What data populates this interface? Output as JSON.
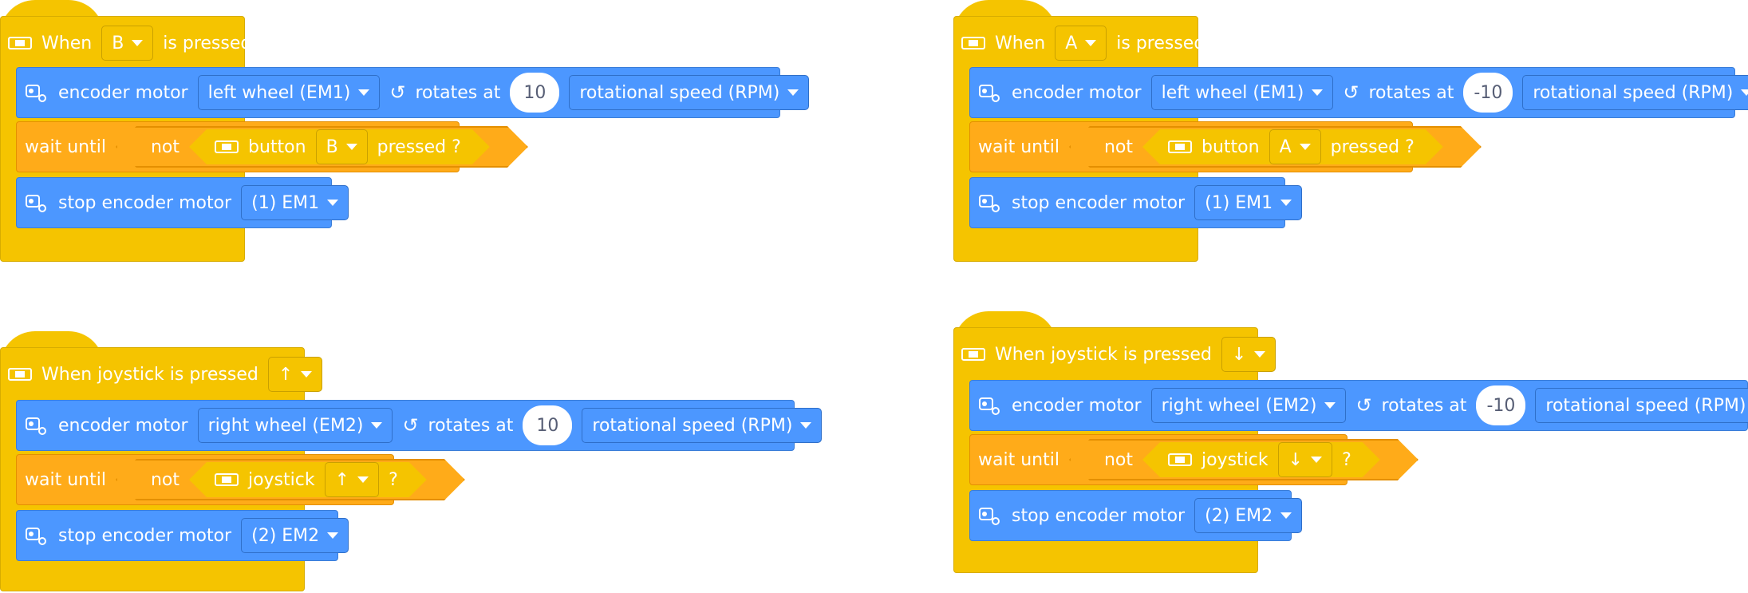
{
  "scripts": [
    {
      "hat": {
        "when": "When",
        "key": "B",
        "suffix": "is pressed"
      },
      "motor": {
        "label": "encoder motor",
        "port": "left wheel (EM1)",
        "rotates": "rotates at",
        "value": "10",
        "unit": "rotational speed (RPM)"
      },
      "wait": {
        "label": "wait until",
        "not": "not",
        "sensor": "button",
        "key": "B",
        "suffix": "pressed ?"
      },
      "stop": {
        "label": "stop encoder motor",
        "port": "(1) EM1"
      }
    },
    {
      "hat": {
        "when": "When",
        "key": "A",
        "suffix": "is pressed"
      },
      "motor": {
        "label": "encoder motor",
        "port": "left wheel (EM1)",
        "rotates": "rotates at",
        "value": "-10",
        "unit": "rotational speed (RPM)"
      },
      "wait": {
        "label": "wait until",
        "not": "not",
        "sensor": "button",
        "key": "A",
        "suffix": "pressed ?"
      },
      "stop": {
        "label": "stop encoder motor",
        "port": "(1) EM1"
      }
    },
    {
      "hat": {
        "when": "When joystick is pressed",
        "key": "↑"
      },
      "motor": {
        "label": "encoder motor",
        "port": "right wheel (EM2)",
        "rotates": "rotates at",
        "value": "10",
        "unit": "rotational speed (RPM)"
      },
      "wait": {
        "label": "wait until",
        "not": "not",
        "sensor": "joystick",
        "key": "↑",
        "suffix": "?"
      },
      "stop": {
        "label": "stop encoder motor",
        "port": "(2) EM2"
      }
    },
    {
      "hat": {
        "when": "When joystick is pressed",
        "key": "↓"
      },
      "motor": {
        "label": "encoder motor",
        "port": "right wheel (EM2)",
        "rotates": "rotates at",
        "value": "-10",
        "unit": "rotational speed (RPM)"
      },
      "wait": {
        "label": "wait until",
        "not": "not",
        "sensor": "joystick",
        "key": "↓",
        "suffix": "?"
      },
      "stop": {
        "label": "stop encoder motor",
        "port": "(2) EM2"
      }
    }
  ],
  "colors": {
    "event": "#F5C400",
    "motion": "#4C97FF",
    "control": "#FFAB19"
  },
  "icons": {
    "device": "cyberpi-board-icon",
    "motor": "encoder-motor-icon",
    "rotate": "rotate-ccw-icon",
    "dropdown": "caret-down-icon"
  }
}
